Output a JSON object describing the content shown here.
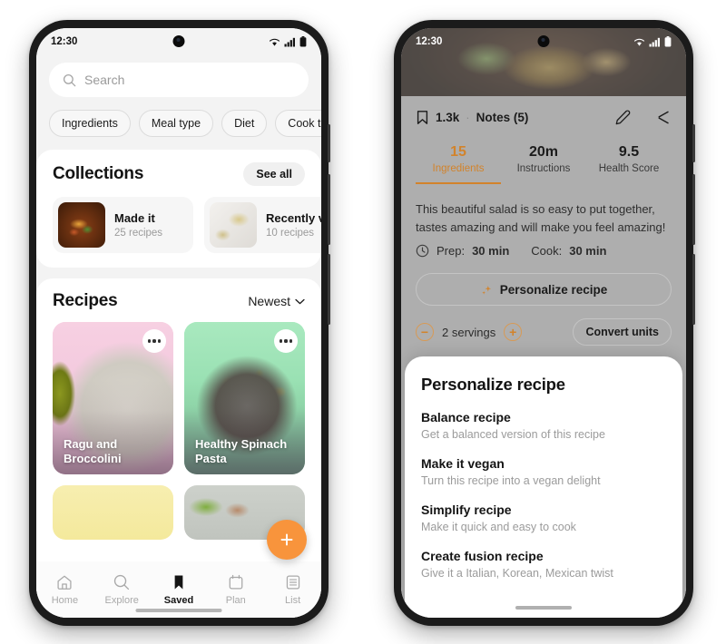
{
  "left_phone": {
    "status": {
      "time": "12:30",
      "icons": [
        "wifi-icon",
        "signal-icon",
        "battery-icon"
      ]
    },
    "search": {
      "placeholder": "Search",
      "icon": "search-icon"
    },
    "chips": [
      "Ingredients",
      "Meal type",
      "Diet",
      "Cook time"
    ],
    "collections": {
      "title": "Collections",
      "see_all": "See all",
      "items": [
        {
          "name": "Made it",
          "count": "25 recipes"
        },
        {
          "name": "Recently viewed",
          "count": "10 recipes"
        }
      ]
    },
    "recipes": {
      "title": "Recipes",
      "sort": "Newest",
      "sort_icon": "chevron-down-icon",
      "cards": [
        {
          "title": "Ragu and Broccolini",
          "bg": "#f7d0e2",
          "menu_icon": "more-options-icon"
        },
        {
          "title": "Healthy Spinach Pasta",
          "bg": "#a9e9bf",
          "menu_icon": "more-options-icon"
        }
      ],
      "peek_cards": [
        {
          "bg": "#f7eeb0"
        },
        {
          "bg": "#c8cdc6"
        }
      ]
    },
    "fab": {
      "label": "+",
      "icon": "add-icon",
      "color": "#f8943c"
    },
    "bottom_nav": [
      {
        "label": "Home",
        "icon": "home-icon",
        "active": false
      },
      {
        "label": "Explore",
        "icon": "search-icon",
        "active": false
      },
      {
        "label": "Saved",
        "icon": "bookmark-icon",
        "active": true
      },
      {
        "label": "Plan",
        "icon": "calendar-icon",
        "active": false
      },
      {
        "label": "List",
        "icon": "list-icon",
        "active": false
      }
    ]
  },
  "right_phone": {
    "status": {
      "time": "12:30",
      "icons": [
        "wifi-icon",
        "signal-icon",
        "battery-icon"
      ]
    },
    "detail_bar": {
      "bookmark_icon": "bookmark-icon",
      "bookmark_count": "1.3k",
      "separator": "·",
      "notes_label": "Notes (5)",
      "edit_icon": "pencil-icon",
      "share_icon": "share-icon"
    },
    "stats": [
      {
        "value": "15",
        "label": "Ingredients",
        "active": true
      },
      {
        "value": "20m",
        "label": "Instructions",
        "active": false
      },
      {
        "value": "9.5",
        "label": "Health Score",
        "active": false
      }
    ],
    "description": "This beautiful salad is so easy to put together, tastes amazing and will make you feel amazing!",
    "timeline": {
      "clock_icon": "clock-icon",
      "prep_label": "Prep:",
      "prep_value": "30 min",
      "cook_label": "Cook:",
      "cook_value": "30 min"
    },
    "personalize_button": {
      "label": "Personalize recipe",
      "icon": "sparkle-icon"
    },
    "servings": {
      "minus_icon": "minus-icon",
      "label": "2 servings",
      "plus_icon": "plus-icon",
      "convert_label": "Convert units"
    },
    "sheet": {
      "title": "Personalize recipe",
      "options": [
        {
          "title": "Balance recipe",
          "subtitle": "Get a balanced version of this recipe"
        },
        {
          "title": "Make it vegan",
          "subtitle": "Turn this recipe into a vegan delight"
        },
        {
          "title": "Simplify recipe",
          "subtitle": "Make it quick and easy to cook"
        },
        {
          "title": "Create fusion recipe",
          "subtitle": "Give it a Italian, Korean, Mexican twist"
        }
      ]
    }
  },
  "theme": {
    "accent": "#f8943c",
    "accent_dark": "#d2832b",
    "frame": "#1b1b1b"
  }
}
